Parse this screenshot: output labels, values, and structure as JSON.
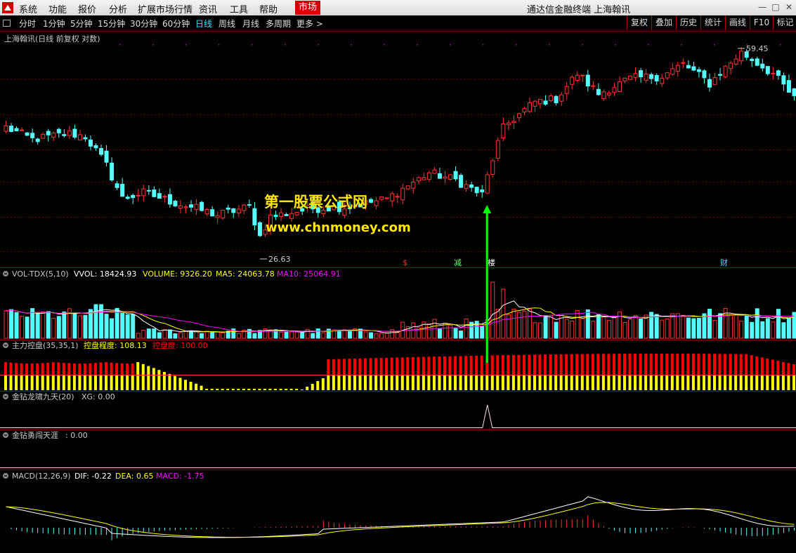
{
  "menu": {
    "items": [
      "系统",
      "功能",
      "报价",
      "分析",
      "扩展市场行情",
      "资讯",
      "工具",
      "帮助"
    ],
    "active_item": "市场",
    "window_title": "通达信金融终端 上海翰讯"
  },
  "toolbar": {
    "periods": [
      "分时",
      "1分钟",
      "5分钟",
      "15分钟",
      "30分钟",
      "60分钟",
      "日线",
      "周线",
      "月线",
      "多周期",
      "更多 >"
    ],
    "selected": "日线",
    "right_buttons": [
      "复权",
      "叠加",
      "历史",
      "统计",
      "画线",
      "F10",
      "标记"
    ]
  },
  "main_panel": {
    "title": "上海翰讯(日线 前复权 对数)",
    "high_label": "59.45",
    "low_label": "26.63",
    "markers": [
      {
        "text": "$",
        "color": "#ff3030"
      },
      {
        "text": "减",
        "color": "#66ff66"
      },
      {
        "text": "楼",
        "color": "#ffffff"
      },
      {
        "text": "财",
        "color": "#66ccff"
      }
    ],
    "watermark_line1": "第一股票公式网",
    "watermark_line2": "www.chnmoney.com"
  },
  "vol_panel": {
    "name": "VOL-TDX(5,10)",
    "vvol": "VVOL: 18424.93",
    "volume": "VOLUME: 9326.20",
    "ma5": "MA5: 24063.78",
    "ma10": "MA10: 25064.91"
  },
  "control_panel": {
    "name": "主力控盘(35,35,1)",
    "degree": "控盘程度: 108.13",
    "ctrl": "控盘度: 100.00"
  },
  "jz_panel": {
    "name": "金钻龙啸九天(20)",
    "xg": "XG: 0.00"
  },
  "yc_panel": {
    "name": "金钻勇闯天涯",
    "value": ": 0.00"
  },
  "macd_panel": {
    "name": "MACD(12,26,9)",
    "dif": "DIF: -0.22",
    "dea": "DEA: 0.65",
    "macd": "MACD: -1.75"
  },
  "colors": {
    "up": "#ff3232",
    "down": "#54fcfc",
    "ma5": "#ffffff",
    "ma10": "#ffff00",
    "ma20": "#ff00ff",
    "arrow": "#00ff00",
    "ctrl_red": "#ff0000",
    "ctrl_yellow": "#ffff00"
  },
  "chart_data": {
    "type": "candlestick",
    "axis": "log",
    "n": 150,
    "anchors": [
      [
        0,
        44.0
      ],
      [
        5,
        42.0
      ],
      [
        12,
        43.0
      ],
      [
        15,
        42.5
      ],
      [
        19,
        38.0
      ],
      [
        22,
        33.5
      ],
      [
        26,
        34.3
      ],
      [
        32,
        33.0
      ],
      [
        40,
        31.5
      ],
      [
        46,
        32.5
      ],
      [
        48,
        29.0
      ],
      [
        50,
        31.3
      ],
      [
        58,
        32.3
      ],
      [
        65,
        32.5
      ],
      [
        72,
        33.5
      ],
      [
        80,
        37.0
      ],
      [
        85,
        36.0
      ],
      [
        90,
        34.0
      ],
      [
        94,
        44.0
      ],
      [
        100,
        48.5
      ],
      [
        104,
        49.0
      ],
      [
        108,
        54.0
      ],
      [
        112,
        50.0
      ],
      [
        118,
        53.0
      ],
      [
        124,
        53.5
      ],
      [
        128,
        56.0
      ],
      [
        133,
        52.0
      ],
      [
        139,
        58.5
      ],
      [
        145,
        54.0
      ],
      [
        149,
        49.0
      ]
    ],
    "high_price": 59.45,
    "low_price": 26.63,
    "signal_index": 91,
    "xg_signal_index": 91
  }
}
